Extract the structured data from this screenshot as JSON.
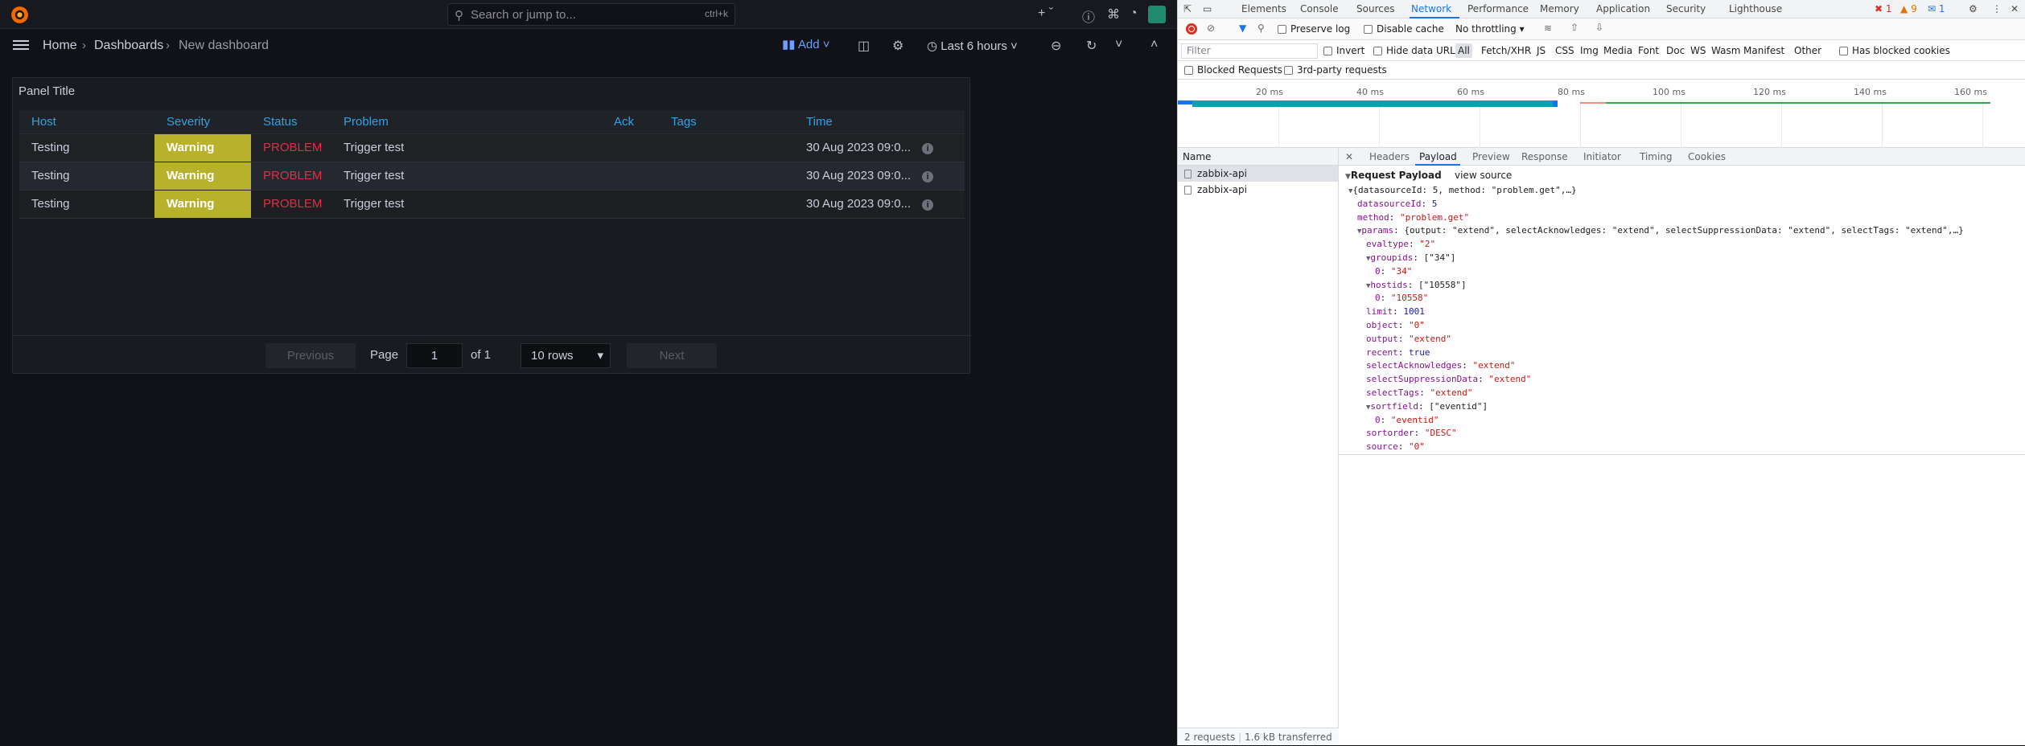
{
  "grafana": {
    "search": {
      "placeholder": "Search or jump to...",
      "shortcut": "ctrl+k"
    },
    "breadcrumb": [
      "Home",
      "Dashboards",
      "New dashboard"
    ],
    "toolbar": {
      "add_label": "Add",
      "time_range": "Last 6 hours"
    },
    "panel": {
      "title": "Panel Title",
      "columns": [
        "Host",
        "Severity",
        "Status",
        "Problem",
        "Ack",
        "Tags",
        "Time"
      ],
      "rows": [
        {
          "host": "Testing",
          "severity": "Warning",
          "status": "PROBLEM",
          "problem": "Trigger test",
          "ack": "",
          "tags": "",
          "time": "30 Aug 2023 09:0..."
        },
        {
          "host": "Testing",
          "severity": "Warning",
          "status": "PROBLEM",
          "problem": "Trigger test",
          "ack": "",
          "tags": "",
          "time": "30 Aug 2023 09:0..."
        },
        {
          "host": "Testing",
          "severity": "Warning",
          "status": "PROBLEM",
          "problem": "Trigger test",
          "ack": "",
          "tags": "",
          "time": "30 Aug 2023 09:0..."
        }
      ],
      "pagination": {
        "previous": "Previous",
        "page_label": "Page",
        "page": "1",
        "of_label": "of 1",
        "rows_select": "10 rows",
        "next": "Next"
      }
    },
    "colors": {
      "severity_warning": "#b7b12b",
      "status_problem": "#e02f44",
      "header_link": "#33a2e5",
      "accent": "#6e9fff"
    }
  },
  "devtools": {
    "tabs": [
      "Elements",
      "Console",
      "Sources",
      "Network",
      "Performance",
      "Memory",
      "Application",
      "Security",
      "Lighthouse"
    ],
    "active_tab": "Network",
    "counts": {
      "errors": "1",
      "warnings": "9",
      "messages": "1"
    },
    "toolbar": {
      "preserve_log": "Preserve log",
      "disable_cache": "Disable cache",
      "throttling": "No throttling"
    },
    "filter": {
      "placeholder": "Filter",
      "invert": "Invert",
      "hide_data_urls": "Hide data URLs",
      "types": [
        "All",
        "Fetch/XHR",
        "JS",
        "CSS",
        "Img",
        "Media",
        "Font",
        "Doc",
        "WS",
        "Wasm",
        "Manifest",
        "Other"
      ],
      "has_blocked_cookies": "Has blocked cookies",
      "blocked_requests": "Blocked Requests",
      "third_party": "3rd-party requests"
    },
    "timeline_ticks": [
      "20 ms",
      "40 ms",
      "60 ms",
      "80 ms",
      "100 ms",
      "120 ms",
      "140 ms",
      "160 ms"
    ],
    "requests": {
      "header": "Name",
      "items": [
        "zabbix-api",
        "zabbix-api"
      ],
      "summary_count": "2 requests",
      "summary_size": "1.6 kB transferred"
    },
    "detail_tabs": [
      "Headers",
      "Payload",
      "Preview",
      "Response",
      "Initiator",
      "Timing",
      "Cookies"
    ],
    "payload": {
      "section": "Request Payload",
      "view_source": "view source",
      "lines": [
        {
          "indent": 0,
          "tri": "▼",
          "key": "",
          "val": "{datasourceId: 5, method: \"problem.get\",…}",
          "kind": "p"
        },
        {
          "indent": 1,
          "tri": "",
          "key": "datasourceId",
          "val": "5",
          "kind": "n"
        },
        {
          "indent": 1,
          "tri": "",
          "key": "method",
          "val": "\"problem.get\"",
          "kind": "s"
        },
        {
          "indent": 1,
          "tri": "▼",
          "key": "params",
          "val": "{output: \"extend\", selectAcknowledges: \"extend\", selectSuppressionData: \"extend\", selectTags: \"extend\",…}",
          "kind": "p"
        },
        {
          "indent": 2,
          "tri": "",
          "key": "evaltype",
          "val": "\"2\"",
          "kind": "s"
        },
        {
          "indent": 2,
          "tri": "▼",
          "key": "groupids",
          "val": "[\"34\"]",
          "kind": "p"
        },
        {
          "indent": 3,
          "tri": "",
          "key": "0",
          "val": "\"34\"",
          "kind": "s"
        },
        {
          "indent": 2,
          "tri": "▼",
          "key": "hostids",
          "val": "[\"10558\"]",
          "kind": "p"
        },
        {
          "indent": 3,
          "tri": "",
          "key": "0",
          "val": "\"10558\"",
          "kind": "s"
        },
        {
          "indent": 2,
          "tri": "",
          "key": "limit",
          "val": "1001",
          "kind": "n"
        },
        {
          "indent": 2,
          "tri": "",
          "key": "object",
          "val": "\"0\"",
          "kind": "s"
        },
        {
          "indent": 2,
          "tri": "",
          "key": "output",
          "val": "\"extend\"",
          "kind": "s"
        },
        {
          "indent": 2,
          "tri": "",
          "key": "recent",
          "val": "true",
          "kind": "n"
        },
        {
          "indent": 2,
          "tri": "",
          "key": "selectAcknowledges",
          "val": "\"extend\"",
          "kind": "s"
        },
        {
          "indent": 2,
          "tri": "",
          "key": "selectSuppressionData",
          "val": "\"extend\"",
          "kind": "s"
        },
        {
          "indent": 2,
          "tri": "",
          "key": "selectTags",
          "val": "\"extend\"",
          "kind": "s"
        },
        {
          "indent": 2,
          "tri": "▼",
          "key": "sortfield",
          "val": "[\"eventid\"]",
          "kind": "p"
        },
        {
          "indent": 3,
          "tri": "",
          "key": "0",
          "val": "\"eventid\"",
          "kind": "s"
        },
        {
          "indent": 2,
          "tri": "",
          "key": "sortorder",
          "val": "\"DESC\"",
          "kind": "s"
        },
        {
          "indent": 2,
          "tri": "",
          "key": "source",
          "val": "\"0\"",
          "kind": "s"
        }
      ]
    }
  }
}
